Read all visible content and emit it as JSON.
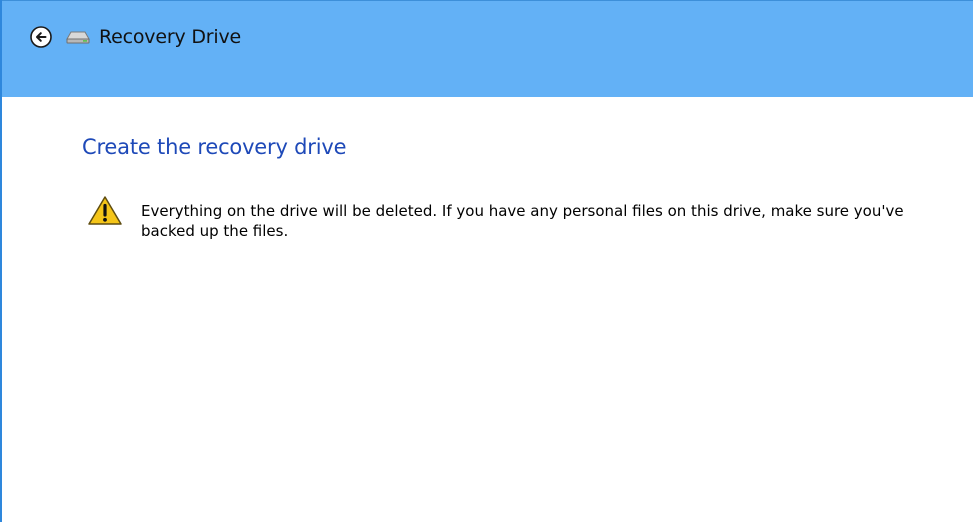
{
  "window": {
    "title": "Recovery Drive"
  },
  "icons": {
    "back": "back-arrow-icon",
    "drive": "drive-icon",
    "warning": "warning-icon"
  },
  "main": {
    "heading": "Create the recovery drive",
    "warning_text": "Everything on the drive will be deleted. If you have any personal files on this drive, make sure you've backed up the files."
  },
  "colors": {
    "titlebar": "#63b1f6",
    "heading": "#1e49b8",
    "warning": "#f5c518"
  }
}
